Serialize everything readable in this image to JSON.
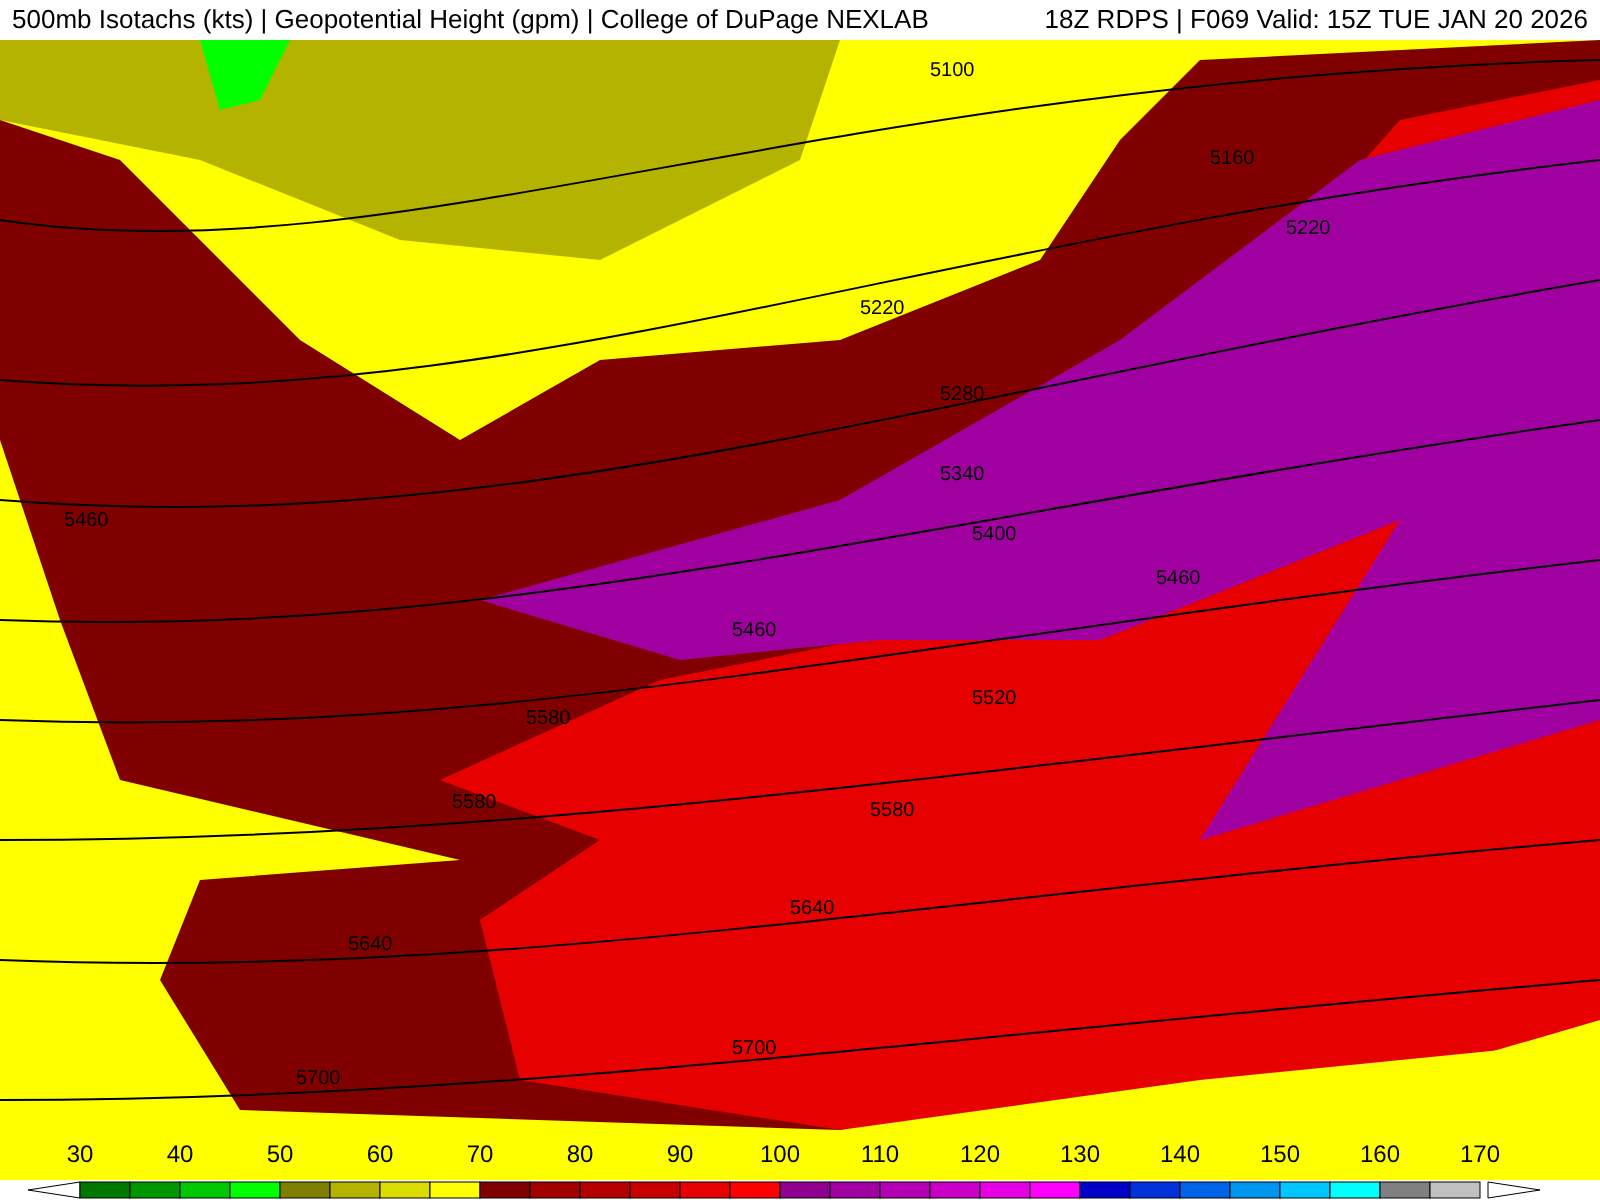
{
  "header": {
    "title": "500mb Isotachs (kts) | Geopotential Height (gpm) | College of DuPage NEXLAB",
    "run": "18Z RDPS | F069 Valid: 15Z TUE JAN 20 2026"
  },
  "map": {
    "contour_labels": [
      "5100",
      "5160",
      "5220",
      "5220",
      "5280",
      "5340",
      "5400",
      "5460",
      "5460",
      "5460",
      "5520",
      "5580",
      "5580",
      "5580",
      "5640",
      "5640",
      "5700",
      "5700"
    ]
  },
  "legend": {
    "labels": [
      "30",
      "40",
      "50",
      "60",
      "70",
      "80",
      "90",
      "100",
      "110",
      "120",
      "130",
      "140",
      "150",
      "160",
      "170"
    ],
    "swatches": [
      {
        "color": "#007800"
      },
      {
        "color": "#009600"
      },
      {
        "color": "#00c800"
      },
      {
        "color": "#00ff00"
      },
      {
        "color": "#808000"
      },
      {
        "color": "#b4b400"
      },
      {
        "color": "#dcdc00"
      },
      {
        "color": "#ffff00"
      },
      {
        "color": "#800000"
      },
      {
        "color": "#a00000"
      },
      {
        "color": "#b40000"
      },
      {
        "color": "#c80000"
      },
      {
        "color": "#e60000"
      },
      {
        "color": "#ff0000"
      },
      {
        "color": "#900090"
      },
      {
        "color": "#a000a0"
      },
      {
        "color": "#b400b4"
      },
      {
        "color": "#c800c8"
      },
      {
        "color": "#e600e6"
      },
      {
        "color": "#ff00ff"
      },
      {
        "color": "#0000c8"
      },
      {
        "color": "#0032dc"
      },
      {
        "color": "#0064e6"
      },
      {
        "color": "#0096f0"
      },
      {
        "color": "#00c8ff"
      },
      {
        "color": "#00ffff"
      },
      {
        "color": "#808080"
      },
      {
        "color": "#c0c0c0"
      }
    ]
  }
}
